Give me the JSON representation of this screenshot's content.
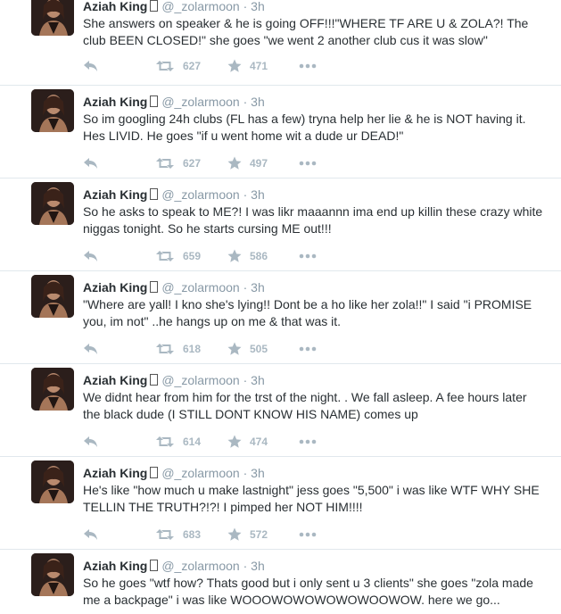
{
  "tweets": [
    {
      "name": "Aziah King",
      "handle": "@_zolarmoon",
      "time": "3h",
      "text": "She answers on speaker & he is going OFF!!!\"WHERE TF ARE U & ZOLA?! The club BEEN CLOSED!\" she goes \"we went 2 another club cus it was slow\"",
      "retweets": "627",
      "favorites": "471"
    },
    {
      "name": "Aziah King",
      "handle": "@_zolarmoon",
      "time": "3h",
      "text": "So im googling 24h clubs (FL has a few) tryna help her lie & he is NOT having it. Hes LIVID. He goes \"if u went home wit a dude ur DEAD!\"",
      "retweets": "627",
      "favorites": "497"
    },
    {
      "name": "Aziah King",
      "handle": "@_zolarmoon",
      "time": "3h",
      "text": "So he asks to speak to ME?! I was likr maaannn ima end up killin these crazy white niggas tonight. So he starts cursing ME out!!!",
      "retweets": "659",
      "favorites": "586"
    },
    {
      "name": "Aziah King",
      "handle": "@_zolarmoon",
      "time": "3h",
      "text": "\"Where are yall! I kno she's lying!! Dont be a ho like her zola!!\" I said \"i PROMISE you, im not\" ..he hangs up on me & that was it.",
      "retweets": "618",
      "favorites": "505"
    },
    {
      "name": "Aziah King",
      "handle": "@_zolarmoon",
      "time": "3h",
      "text": "We didnt hear from him for the trst of the night. . We fall asleep. A fee hours later the black dude (I STILL DONT KNOW HIS NAME) comes up",
      "retweets": "614",
      "favorites": "474"
    },
    {
      "name": "Aziah King",
      "handle": "@_zolarmoon",
      "time": "3h",
      "text": "He's like \"how much u make lastnight\" jess goes \"5,500\" i was like WTF WHY SHE TELLIN THE TRUTH?!?! I pimped her NOT HIM!!!!",
      "retweets": "683",
      "favorites": "572"
    },
    {
      "name": "Aziah King",
      "handle": "@_zolarmoon",
      "time": "3h",
      "text": "So he goes \"wtf how? Thats good but i only sent u 3 clients\" she goes \"zola made me a backpage\" i was like WOOOWOWOWOWOWOOWOW. here we go...",
      "retweets": "",
      "favorites": ""
    }
  ],
  "icons": {
    "reply": "reply-icon",
    "retweet": "retweet-icon",
    "favorite": "star-icon",
    "more": "more-dots-icon",
    "emoji": "emoji-box-icon"
  },
  "colors": {
    "name": "#292f33",
    "meta": "#8899a6",
    "action": "#aab8c2",
    "divider": "#e1e8ed"
  }
}
